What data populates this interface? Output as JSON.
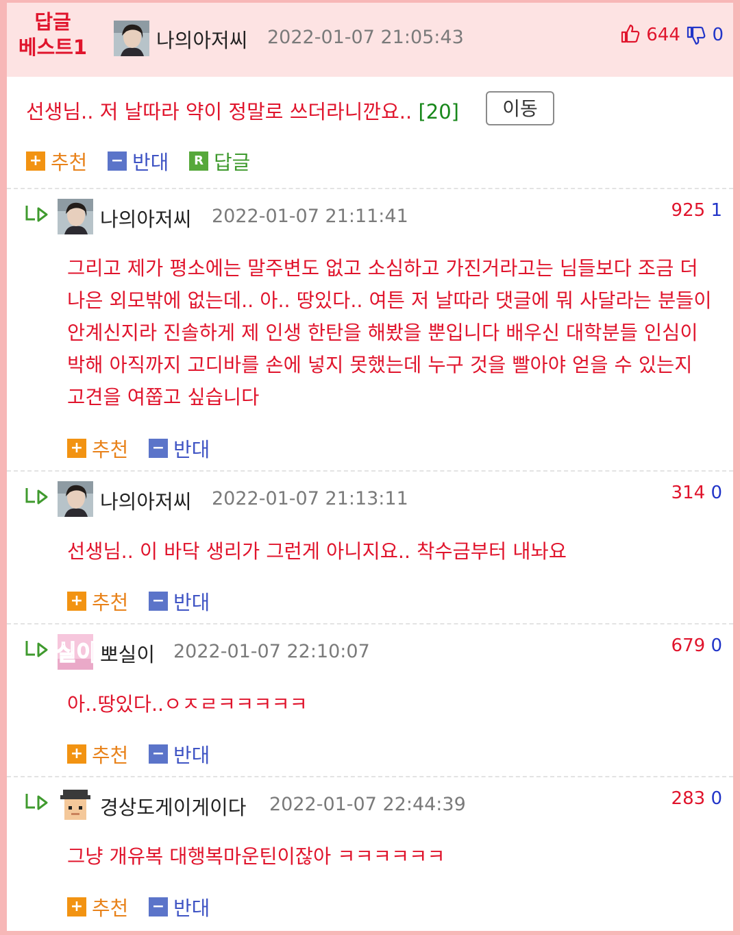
{
  "best": {
    "badge_line1": "답글",
    "badge_line2": "베스트1",
    "nickname": "나의아저씨",
    "datetime": "2022-01-07 21:05:43",
    "upvotes": "644",
    "downvotes": "0",
    "title": "선생님.. 저 날따라 약이 정말로 쓰더라니깐요..",
    "reply_count": "[20]",
    "move_label": "이동",
    "actions": {
      "recommend": "추천",
      "oppose": "반대",
      "reply": "답글"
    }
  },
  "comments": [
    {
      "nickname": "나의아저씨",
      "datetime": "2022-01-07 21:11:41",
      "upvotes": "925",
      "downvotes": "1",
      "text": "그리고 제가 평소에는 말주변도 없고 소심하고 가진거라고는 님들보다 조금 더 나은 외모밖에 없는데.. 아.. 땅있다.. 여튼 저 날따라 댓글에 뭐 사달라는 분들이 안계신지라 진솔하게 제 인생 한탄을 해봤을 뿐입니다 배우신 대학분들 인심이 박해 아직까지 고디바를 손에 넣지 못했는데 누구 것을 빨아야 얻을 수 있는지 고견을 여쭙고 싶습니다",
      "recommend": "추천",
      "oppose": "반대"
    },
    {
      "nickname": "나의아저씨",
      "datetime": "2022-01-07 21:13:11",
      "upvotes": "314",
      "downvotes": "0",
      "text": "선생님.. 이 바닥 생리가 그런게 아니지요.. 착수금부터 내놔요",
      "recommend": "추천",
      "oppose": "반대"
    },
    {
      "nickname": "뽀실이",
      "avatar_text": "실이",
      "datetime": "2022-01-07 22:10:07",
      "upvotes": "679",
      "downvotes": "0",
      "text": "아..땅있다..ㅇㅈㄹㅋㅋㅋㅋㅋ",
      "recommend": "추천",
      "oppose": "반대"
    },
    {
      "nickname": "경상도게이게이다",
      "datetime": "2022-01-07 22:44:39",
      "upvotes": "283",
      "downvotes": "0",
      "text": "그냥 개유복 대행복마운틴이잖아 ㅋㅋㅋㅋㅋㅋ",
      "recommend": "추천",
      "oppose": "반대"
    }
  ],
  "icons": {
    "thumbs_up": "thumbs-up-icon",
    "thumbs_down": "thumbs-down-icon",
    "reply_arrow": "reply-arrow-icon",
    "plus": "plus-icon",
    "minus": "minus-icon",
    "r_badge": "reply-r-icon"
  },
  "colors": {
    "accent_red": "#e0142c",
    "vote_blue": "#2235c8",
    "header_bg": "#fde3e3",
    "frame_pink": "#f7b7b7",
    "recommend_orange": "#f29312",
    "oppose_blue": "#5b74c9",
    "reply_green": "#56a83a"
  }
}
